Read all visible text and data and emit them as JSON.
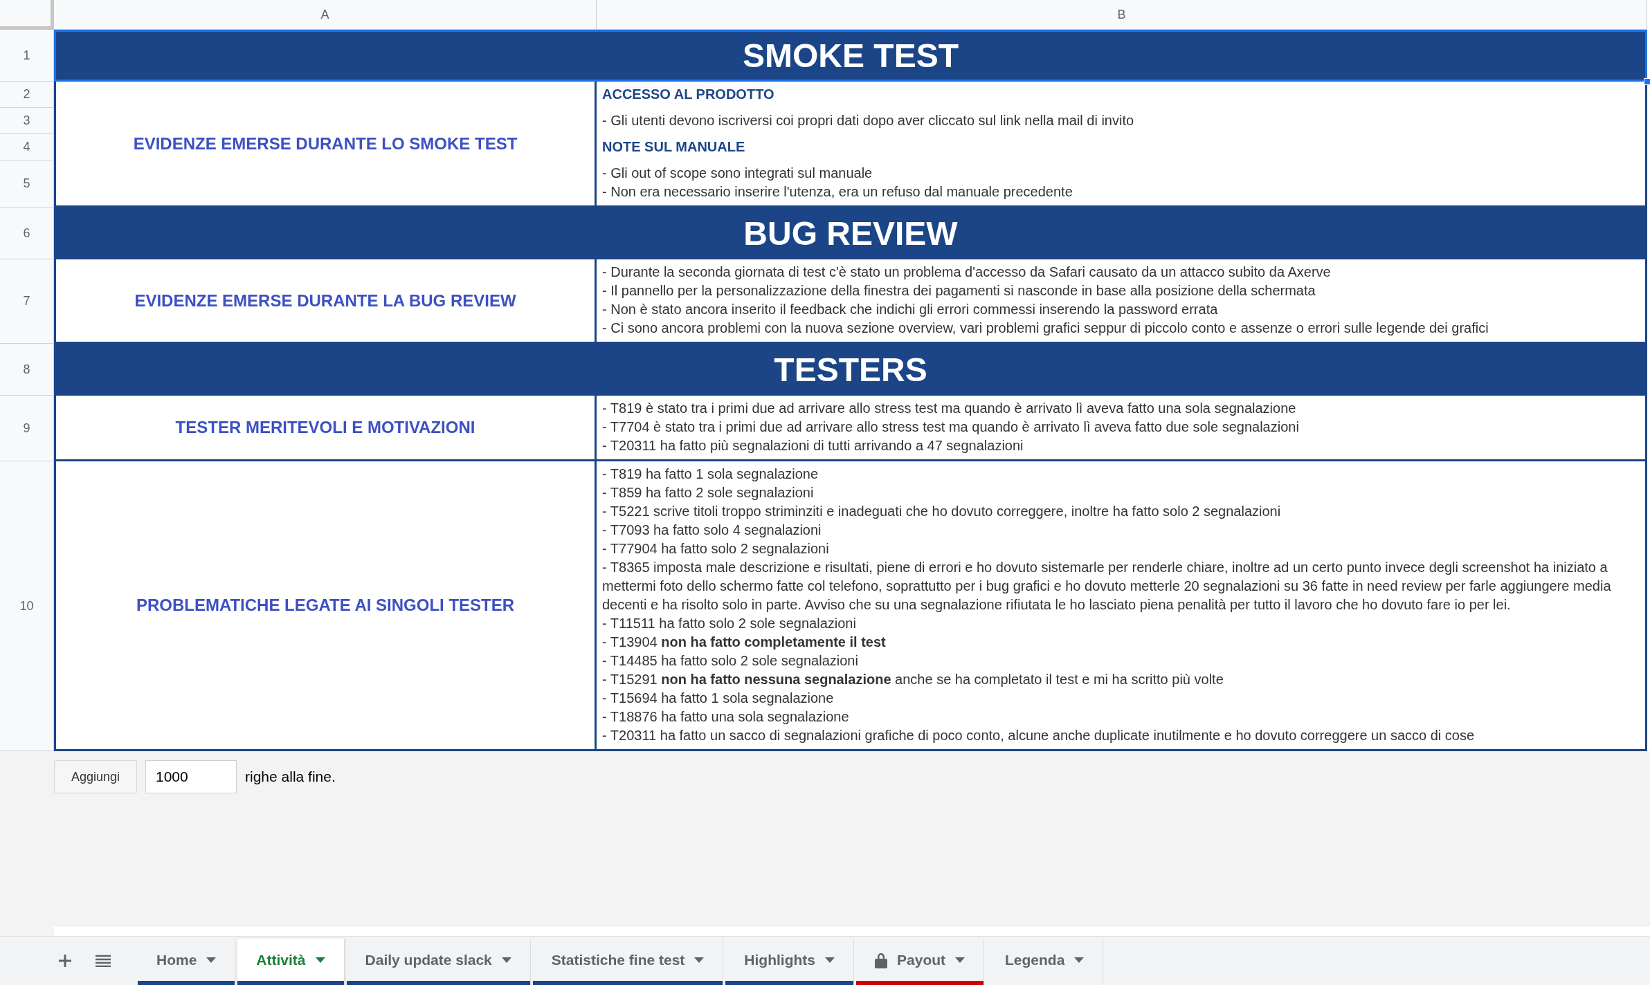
{
  "columns": [
    "A",
    "B"
  ],
  "rows": [
    {
      "kind": "title",
      "number": "1",
      "text": "SMOKE TEST",
      "selected": true
    },
    {
      "kind": "section",
      "label": "EVIDENZE EMERSE DURANTE LO SMOKE TEST",
      "selected": false,
      "rows": [
        {
          "number": "2",
          "lines": [
            {
              "kind": "heading",
              "text": "ACCESSO AL PRODOTTO"
            }
          ]
        },
        {
          "number": "3",
          "lines": [
            {
              "kind": "text",
              "text": "- Gli utenti devono iscriversi coi propri dati dopo aver cliccato sul link nella mail di invito"
            }
          ]
        },
        {
          "number": "4",
          "lines": [
            {
              "kind": "heading",
              "text": "NOTE SUL MANUALE"
            }
          ]
        },
        {
          "number": "5",
          "lines": [
            {
              "kind": "text",
              "text": "- Gli out of scope sono integrati sul manuale"
            },
            {
              "kind": "text",
              "text": "- Non era necessario inserire l'utenza, era un refuso dal manuale precedente"
            }
          ]
        }
      ]
    },
    {
      "kind": "title",
      "number": "6",
      "text": "BUG REVIEW",
      "selected": false
    },
    {
      "kind": "section",
      "label": "EVIDENZE EMERSE DURANTE LA BUG REVIEW",
      "selected": false,
      "rows": [
        {
          "number": "7",
          "lines": [
            {
              "kind": "text",
              "text": "- Durante la seconda giornata di test c'è stato un problema d'accesso da Safari causato da un attacco subito da Axerve"
            },
            {
              "kind": "text",
              "text": "- Il pannello per la personalizzazione della finestra dei pagamenti si nasconde in base alla posizione della schermata"
            },
            {
              "kind": "text",
              "text": "- Non è stato ancora inserito il feedback che indichi gli errori commessi inserendo la password errata"
            },
            {
              "kind": "text",
              "text": "- Ci sono ancora problemi con la nuova sezione overview, vari problemi grafici seppur di piccolo conto e assenze o errori sulle legende dei grafici"
            }
          ]
        }
      ]
    },
    {
      "kind": "title",
      "number": "8",
      "text": "TESTERS",
      "selected": false
    },
    {
      "kind": "section",
      "label": "TESTER MERITEVOLI E MOTIVAZIONI",
      "selected": false,
      "rows": [
        {
          "number": "9",
          "lines": [
            {
              "kind": "text",
              "text": "- T819 è stato tra i primi due ad arrivare allo stress test ma quando è arrivato lì aveva fatto una sola segnalazione"
            },
            {
              "kind": "text",
              "text": "- T7704 è stato tra i primi due ad arrivare allo stress test ma quando è arrivato lì aveva fatto due sole segnalazioni"
            },
            {
              "kind": "text",
              "text": "- T20311 ha fatto più segnalazioni di tutti arrivando a 47 segnalazioni"
            }
          ]
        }
      ]
    },
    {
      "kind": "section",
      "label": "PROBLEMATICHE LEGATE AI SINGOLI TESTER",
      "selected": false,
      "rows": [
        {
          "number": "10",
          "lines": [
            {
              "kind": "text",
              "text": "- T819 ha fatto 1 sola segnalazione"
            },
            {
              "kind": "text",
              "text": "- T859 ha fatto 2 sole segnalazioni"
            },
            {
              "kind": "text",
              "text": "- T5221 scrive titoli troppo striminziti e inadeguati che ho dovuto correggere, inoltre ha fatto solo 2 segnalazioni"
            },
            {
              "kind": "text",
              "text": "- T7093 ha fatto solo 4 segnalazioni"
            },
            {
              "kind": "text",
              "text": "- T77904 ha fatto solo 2 segnalazioni"
            },
            {
              "kind": "text",
              "text": "- T8365 imposta male descrizione e risultati, piene di errori e ho dovuto sistemarle per renderle chiare, inoltre ad un certo punto invece degli screenshot ha iniziato a mettermi foto dello schermo fatte col telefono, soprattutto per i bug grafici e ho dovuto metterle 20 segnalazioni su 36 fatte in need review per farle aggiungere media decenti e ha risolto solo in parte. Avviso che su una segnalazione rifiutata le ho lasciato piena penalità per tutto il lavoro che ho dovuto fare io per lei."
            },
            {
              "kind": "text",
              "text": "- T11511 ha fatto solo 2 sole segnalazioni"
            },
            {
              "kind": "text",
              "text": "- T13904 **non ha fatto completamente il test**"
            },
            {
              "kind": "text",
              "text": "- T14485 ha fatto solo 2 sole segnalazioni"
            },
            {
              "kind": "text",
              "text": "- T15291 **non ha fatto nessuna segnalazione** anche se ha completato il test e mi ha scritto più volte"
            },
            {
              "kind": "text",
              "text": "- T15694 ha fatto 1 sola segnalazione"
            },
            {
              "kind": "text",
              "text": "- T18876 ha fatto una sola segnalazione"
            },
            {
              "kind": "text",
              "text": "- T20311 ha fatto un sacco di segnalazioni grafiche di poco conto, alcune anche duplicate inutilmente e ho dovuto correggere un sacco di cose"
            }
          ]
        }
      ]
    }
  ],
  "footer": {
    "button": "Aggiungi",
    "input_value": "1000",
    "suffix": "righe alla fine."
  },
  "tabs": [
    {
      "label": "Home",
      "selected": false,
      "locked": false,
      "color": "#1c4587"
    },
    {
      "label": "Attività",
      "selected": true,
      "locked": false,
      "color": "#1c4587"
    },
    {
      "label": "Daily update slack",
      "selected": false,
      "locked": false,
      "color": "#1c4587"
    },
    {
      "label": "Statistiche fine test",
      "selected": false,
      "locked": false,
      "color": "#1c4587"
    },
    {
      "label": "Highlights",
      "selected": false,
      "locked": false,
      "color": "#1c4587"
    },
    {
      "label": "Payout",
      "selected": false,
      "locked": true,
      "color": "#cc0000"
    },
    {
      "label": "Legenda",
      "selected": false,
      "locked": false
    }
  ]
}
